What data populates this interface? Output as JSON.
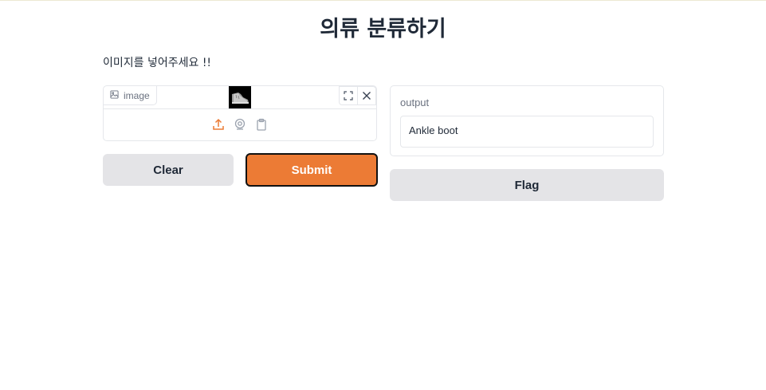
{
  "header": {
    "title": "의류 분류하기"
  },
  "description": "이미지를 넣어주세요 !!",
  "image_input": {
    "label": "image",
    "label_icon": "image-icon",
    "toolbar": [
      "fullscreen-icon",
      "close-icon"
    ],
    "sources": [
      "upload-icon",
      "webcam-icon",
      "clipboard-icon"
    ],
    "source_accent": "#ec7b35"
  },
  "buttons": {
    "clear": "Clear",
    "submit": "Submit",
    "flag": "Flag"
  },
  "output": {
    "label": "output",
    "value": "Ankle boot"
  },
  "colors": {
    "primary": "#ec7b35",
    "secondary": "#e4e4e7",
    "border": "#e5e7eb"
  }
}
